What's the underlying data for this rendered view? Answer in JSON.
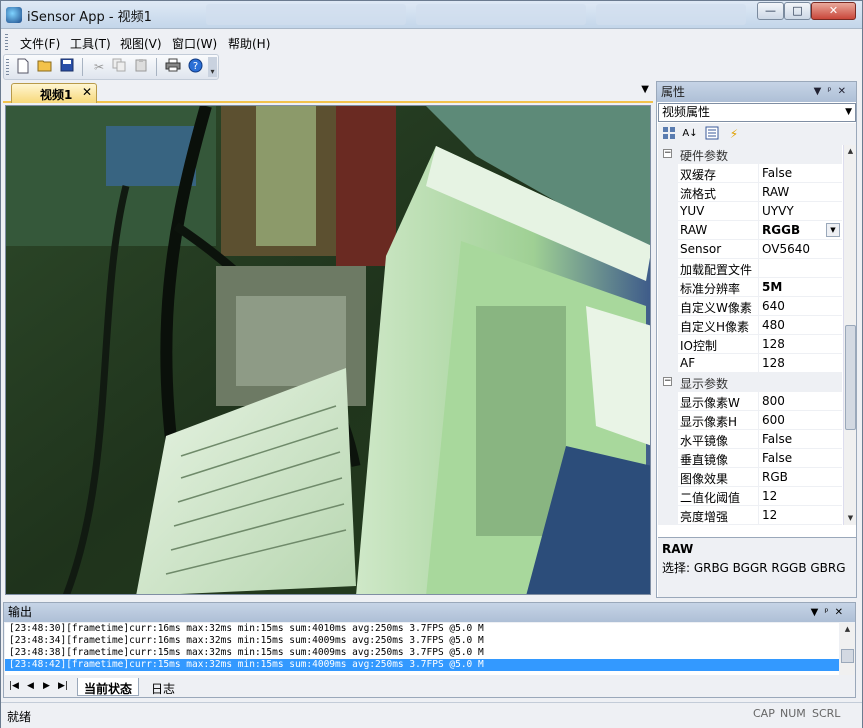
{
  "window": {
    "title": "iSensor App - 视频1",
    "minimize": "—",
    "maximize": "□",
    "close": "✕"
  },
  "menu": [
    "文件(F)",
    "工具(T)",
    "视图(V)",
    "窗口(W)",
    "帮助(H)"
  ],
  "toolbar": {
    "icons": [
      "new-file-icon",
      "open-folder-icon",
      "save-icon",
      "cut-icon",
      "copy-icon",
      "paste-icon",
      "print-icon",
      "help-icon"
    ]
  },
  "document": {
    "tab_label": "视频1",
    "tab_close": "✕",
    "accent": "#f1c24d"
  },
  "properties": {
    "title": "属性",
    "selector": "视频属性",
    "categories": [
      {
        "name": "硬件参数",
        "rows": [
          {
            "name": "双缓存",
            "value": "False"
          },
          {
            "name": "流格式",
            "value": "RAW"
          },
          {
            "name": "YUV",
            "value": "UYVY"
          },
          {
            "name": "RAW",
            "value": "RGGB",
            "bold": true,
            "combo": true
          },
          {
            "name": "Sensor",
            "value": "OV5640"
          },
          {
            "name": "加载配置文件",
            "value": ""
          },
          {
            "name": "标准分辨率",
            "value": "5M",
            "bold": true
          },
          {
            "name": "自定义W像素",
            "value": "640"
          },
          {
            "name": "自定义H像素",
            "value": "480"
          },
          {
            "name": "IO控制",
            "value": "128"
          },
          {
            "name": "AF",
            "value": "128"
          }
        ]
      },
      {
        "name": "显示参数",
        "rows": [
          {
            "name": "显示像素W",
            "value": "800"
          },
          {
            "name": "显示像素H",
            "value": "600"
          },
          {
            "name": "水平镜像",
            "value": "False"
          },
          {
            "name": "垂直镜像",
            "value": "False"
          },
          {
            "name": "图像效果",
            "value": "RGB"
          },
          {
            "name": "二值化阈值",
            "value": "12"
          },
          {
            "name": "亮度增强",
            "value": "12"
          }
        ]
      }
    ],
    "desc_title": "RAW",
    "desc_text": "选择: GRBG BGGR RGGB GBRG"
  },
  "output": {
    "title": "输出",
    "lines": [
      "[23:48:30][frametime]curr:16ms max:32ms min:15ms sum:4010ms avg:250ms 3.7FPS @5.0 M",
      "[23:48:34][frametime]curr:16ms max:32ms min:15ms sum:4009ms avg:250ms 3.7FPS @5.0 M",
      "[23:48:38][frametime]curr:15ms max:32ms min:15ms sum:4009ms avg:250ms 3.7FPS @5.0 M",
      "[23:48:42][frametime]curr:15ms max:32ms min:15ms sum:4009ms avg:250ms 3.7FPS @5.0 M"
    ],
    "selected_index": 3,
    "tabs": [
      "当前状态",
      "日志"
    ]
  },
  "status": {
    "text": "就绪",
    "indicators": [
      "CAP",
      "NUM",
      "SCRL"
    ]
  }
}
